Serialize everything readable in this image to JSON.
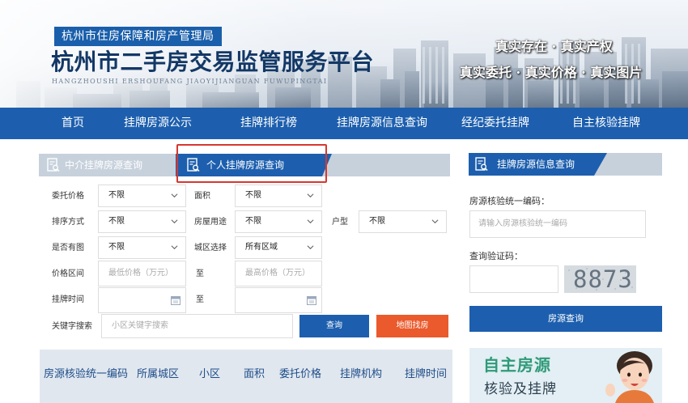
{
  "banner": {
    "bureau": "杭州市住房保障和房产管理局",
    "title": "杭州市二手房交易监管服务平台",
    "pinyin": "HANGZHOUSHI  ERSHOUFANG  JIAOYIJIANGUAN  FUWUPINGTAI",
    "slogan1": "真实存在 · 真实产权",
    "slogan2": "真实委托 · 真实价格 · 真实图片"
  },
  "nav": {
    "items": [
      "首页",
      "挂牌房源公示",
      "挂牌排行榜",
      "挂牌房源信息查询",
      "经纪委托挂牌",
      "自主核验挂牌"
    ]
  },
  "query": {
    "tabs": {
      "agency": "中介挂牌房源查询",
      "personal": "个人挂牌房源查询"
    },
    "labels": {
      "price": "委托价格",
      "area": "面积",
      "sort": "排序方式",
      "usage": "房屋用途",
      "layout": "户型",
      "has_photo": "是否有图",
      "district": "城区选择",
      "price_range": "价格区间",
      "to": "至",
      "list_time": "挂牌时间",
      "keyword": "关键字搜索"
    },
    "selects": {
      "price": "不限",
      "area": "不限",
      "sort": "不限",
      "usage": "不限",
      "layout": "不限",
      "has_photo": "不限",
      "district": "所有区域"
    },
    "placeholders": {
      "min_price": "最低价格（万元）",
      "max_price": "最高价格（万元）",
      "keyword": "小区关键字搜索"
    },
    "buttons": {
      "query": "查询",
      "map": "地图找房"
    }
  },
  "results": {
    "columns": [
      "房源核验统一编码",
      "所属城区",
      "小区",
      "面积",
      "委托价格",
      "挂牌机构",
      "挂牌时间"
    ]
  },
  "right_panel": {
    "title": "挂牌房源信息查询",
    "code_label": "房源核验统一编码：",
    "code_placeholder": "请输入房源核验统一编码",
    "captcha_label": "查询验证码：",
    "captcha_text": "8873",
    "submit": "房源查询"
  },
  "promo": {
    "title": "自主房源",
    "subtitle": "核验及挂牌"
  },
  "colors": {
    "primary": "#1d5fae",
    "accent": "#ea5a2c",
    "highlight": "#d6382f",
    "promo_green": "#2f9a78"
  }
}
